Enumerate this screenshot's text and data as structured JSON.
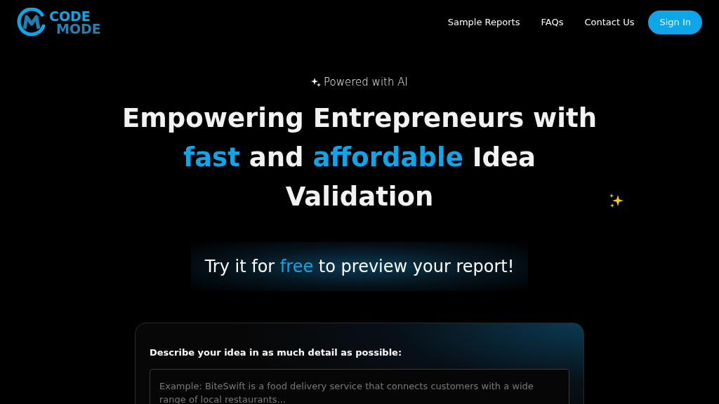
{
  "logo": {
    "line_1": "CODE",
    "line_2": "MODE"
  },
  "nav": {
    "links": [
      "Sample Reports",
      "FAQs",
      "Contact Us"
    ],
    "button": "Sign In"
  },
  "hero": {
    "badge": "Powered with AI",
    "headline": [
      {
        "text": "Empowering Entrepreneurs with",
        "accent": false
      },
      {
        "text": "fast",
        "accent": true
      },
      {
        "text": "and",
        "accent": false
      },
      {
        "text": "affordable",
        "accent": true
      },
      {
        "text": "Idea Validation",
        "accent": false
      }
    ],
    "cta": [
      {
        "text": "Try it for",
        "accent": false
      },
      {
        "text": "free",
        "accent": true
      },
      {
        "text": "to preview your report!",
        "accent": false
      }
    ]
  },
  "form": {
    "label": "Describe your idea in as much detail as possible:",
    "idea_field": {
      "placeholder": "Example: BiteSwift is a food delivery service that connects customers with a wide range of local restaurants..."
    }
  }
}
